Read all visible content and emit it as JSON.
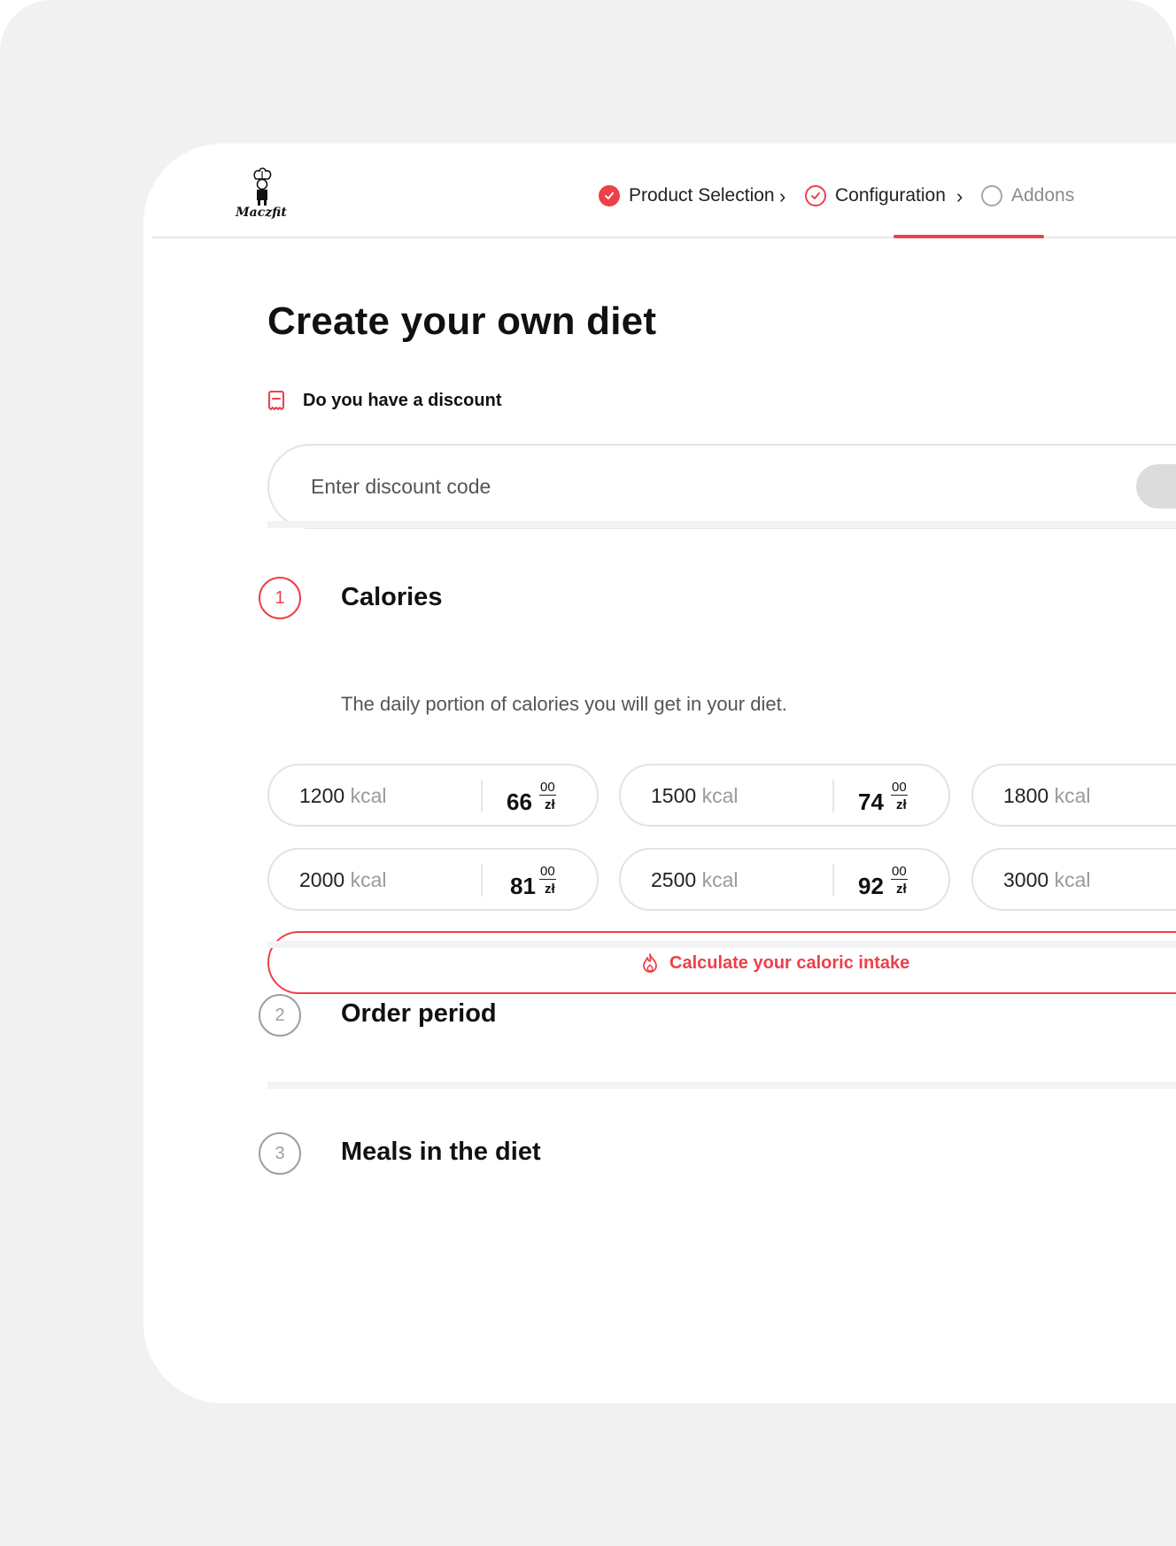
{
  "header": {
    "logo_text": "Maczfit",
    "steps": [
      {
        "label": "Product Selection",
        "state": "completed"
      },
      {
        "label": "Configuration",
        "state": "active"
      },
      {
        "label": "Addons",
        "state": "pending"
      }
    ]
  },
  "page": {
    "title": "Create your own diet"
  },
  "discount": {
    "label": "Do you have a discount",
    "placeholder": "Enter discount code"
  },
  "sections": [
    {
      "number": "1",
      "title": "Calories",
      "subtitle": "The daily portion of calories you will get in your diet."
    },
    {
      "number": "2",
      "title": "Order period"
    },
    {
      "number": "3",
      "title": "Meals in the diet"
    }
  ],
  "calorie_options": [
    {
      "kcal": "1200",
      "unit": "kcal",
      "price": "66",
      "cents": "00",
      "currency": "zł"
    },
    {
      "kcal": "1500",
      "unit": "kcal",
      "price": "74",
      "cents": "00",
      "currency": "zł"
    },
    {
      "kcal": "1800",
      "unit": "kcal"
    },
    {
      "kcal": "2000",
      "unit": "kcal",
      "price": "81",
      "cents": "00",
      "currency": "zł"
    },
    {
      "kcal": "2500",
      "unit": "kcal",
      "price": "92",
      "cents": "00",
      "currency": "zł"
    },
    {
      "kcal": "3000",
      "unit": "kcal"
    }
  ],
  "calculate_button": {
    "label": "Calculate your caloric intake"
  },
  "colors": {
    "accent": "#ef3f4a",
    "background": "#f1f1f1",
    "card": "#ffffff"
  }
}
